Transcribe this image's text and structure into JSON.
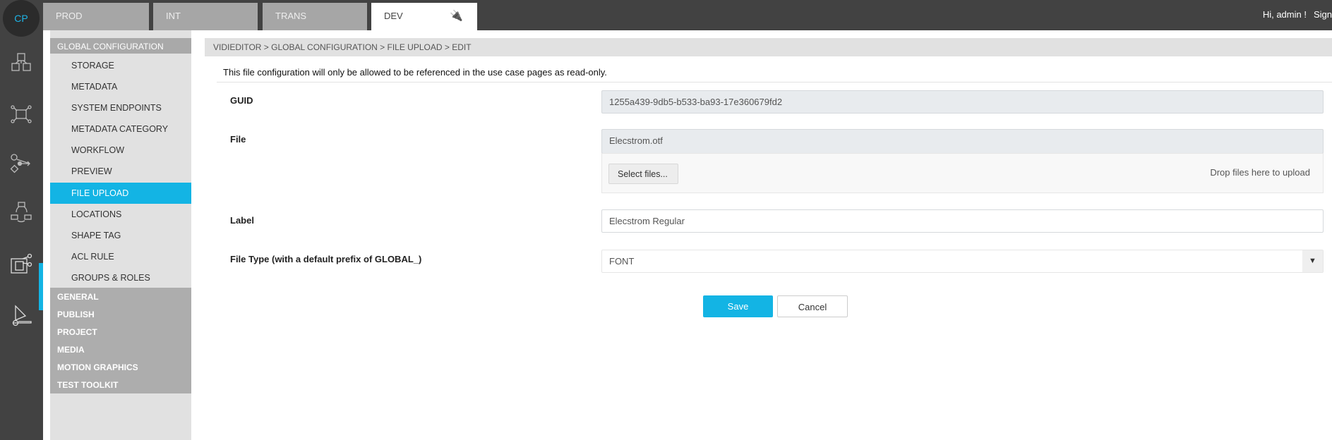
{
  "app": {
    "logo": "CP",
    "greeting": "Hi, admin !",
    "sign": "Sign"
  },
  "tabs": [
    {
      "label": "PROD"
    },
    {
      "label": "INT"
    },
    {
      "label": "TRANS"
    },
    {
      "label": "DEV",
      "icon": "plug-icon"
    }
  ],
  "iconbar": [
    "cubes-icon",
    "network-icon",
    "workflow-icon",
    "cycle-icon",
    "video-editor-icon",
    "media-player-icon"
  ],
  "sidebar": {
    "header": "GLOBAL CONFIGURATION",
    "items": [
      {
        "label": "STORAGE"
      },
      {
        "label": "METADATA"
      },
      {
        "label": "SYSTEM ENDPOINTS"
      },
      {
        "label": "METADATA CATEGORY"
      },
      {
        "label": "WORKFLOW"
      },
      {
        "label": "PREVIEW"
      },
      {
        "label": "FILE UPLOAD",
        "active": true
      },
      {
        "label": "LOCATIONS"
      },
      {
        "label": "SHAPE TAG"
      },
      {
        "label": "ACL RULE"
      },
      {
        "label": "GROUPS & ROLES"
      }
    ],
    "groups": [
      {
        "label": "GENERAL"
      },
      {
        "label": "PUBLISH"
      },
      {
        "label": "PROJECT"
      },
      {
        "label": "MEDIA"
      },
      {
        "label": "MOTION GRAPHICS"
      },
      {
        "label": "TEST TOOLKIT"
      }
    ]
  },
  "breadcrumb": "VIDIEDITOR > GLOBAL CONFIGURATION > FILE UPLOAD > EDIT",
  "notice": "This file configuration will only be allowed to be referenced in the use case pages as read-only.",
  "form": {
    "guid": {
      "label": "GUID",
      "value": "1255a439-9db5-b533-ba93-17e360679fd2"
    },
    "file": {
      "label": "File",
      "value": "Elecstrom.otf",
      "select_label": "Select files...",
      "drop_text": "Drop files here to upload"
    },
    "label": {
      "label": "Label",
      "value": "Elecstrom Regular"
    },
    "file_type": {
      "label": "File Type (with a default prefix of GLOBAL_)",
      "value": "FONT"
    }
  },
  "actions": {
    "save": "Save",
    "cancel": "Cancel"
  },
  "colors": {
    "accent": "#13b4e4",
    "topbar": "#424242"
  }
}
